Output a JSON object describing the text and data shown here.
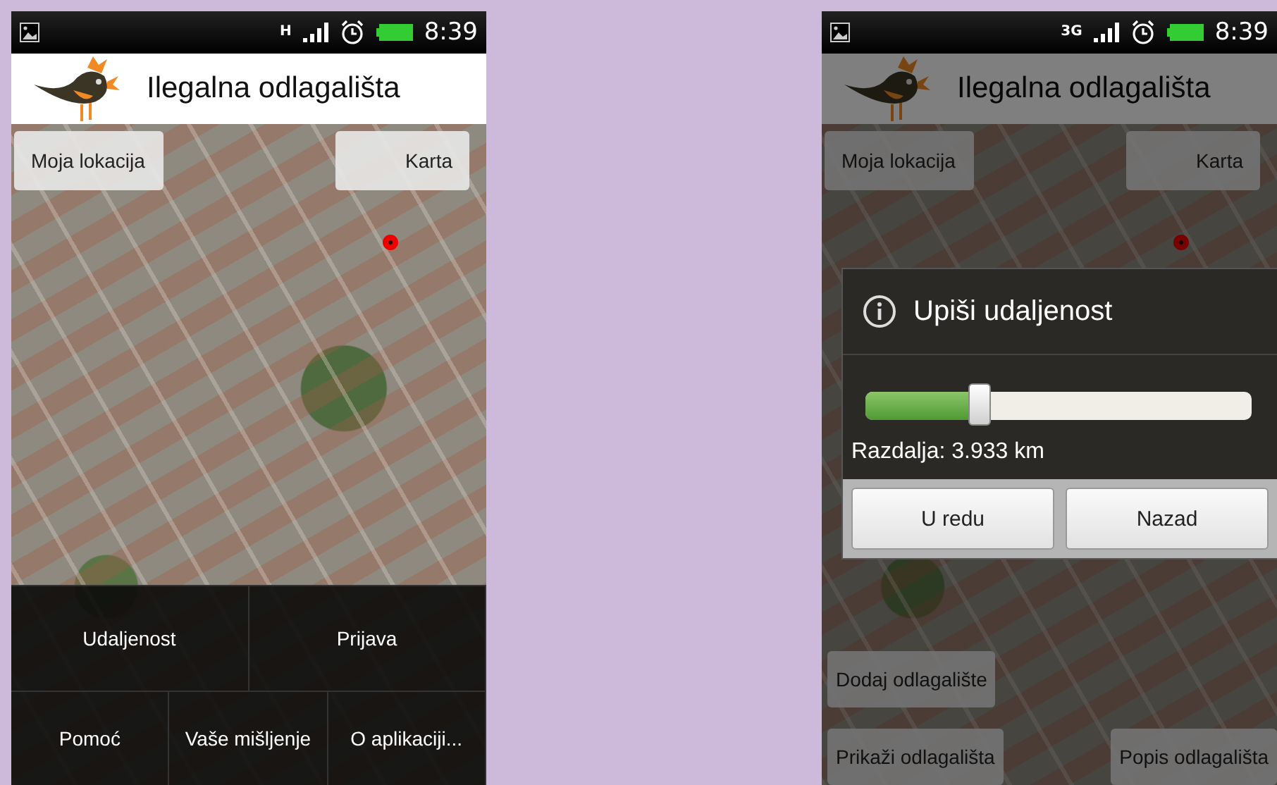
{
  "screens": [
    {
      "status_bar": {
        "network": "H",
        "time": "8:39"
      },
      "app_title": "Ilegalna odlagališta",
      "map_buttons": [
        {
          "label": "Moja lokacija"
        },
        {
          "label": "Karta"
        }
      ],
      "menu": {
        "upper_items": [
          "Udaljenost",
          "Prijava"
        ],
        "lower_items": [
          "Pomoć",
          "Vaše mišljenje",
          "O aplikaciji..."
        ]
      }
    },
    {
      "status_bar": {
        "network": "3G",
        "time": "8:39"
      },
      "app_title": "Ilegalna odlagališta",
      "map_buttons": [
        {
          "label": "Moja lokacija"
        },
        {
          "label": "Karta"
        }
      ],
      "dialog": {
        "title": "Upiši udaljenost",
        "slider": {
          "level": 0.28
        },
        "reading": "Razdalja: 3.933 km",
        "buttons": [
          "U redu",
          "Nazad"
        ]
      },
      "bottom_buttons": [
        {
          "label": "Dodaj odlagalište"
        },
        {
          "label": "Prikaži odlagališta"
        },
        {
          "label": "Popis odlagališta"
        }
      ]
    }
  ]
}
